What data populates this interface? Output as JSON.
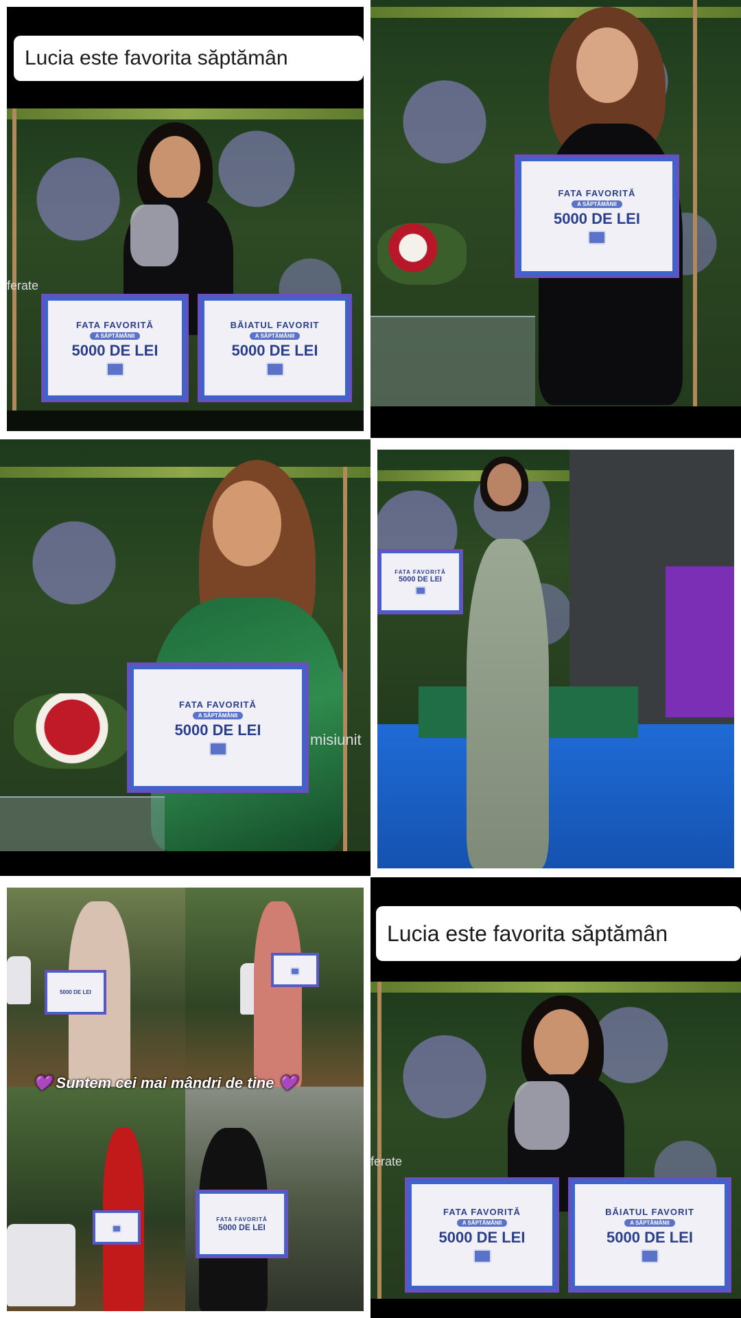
{
  "caption": "Lucia este favorita săptămân",
  "overlay": {
    "text": "Suntem cei mai mândri de tine",
    "heart": "💜"
  },
  "sign": {
    "fata_favorita": "FATA FAVORITĂ",
    "baiatul_favorit": "BĂIATUL FAVORIT",
    "saptamanii": "A SĂPTĂMÂNII",
    "amount": "5000 DE LEI"
  },
  "watermarks": {
    "ferate": "ferate",
    "misiunit": "misiunit"
  },
  "colors": {
    "sign_blue": "#3f63c9",
    "sign_border": "#6b4fc0",
    "caption_bg": "#ffffff",
    "heart": "#b65cf0"
  }
}
